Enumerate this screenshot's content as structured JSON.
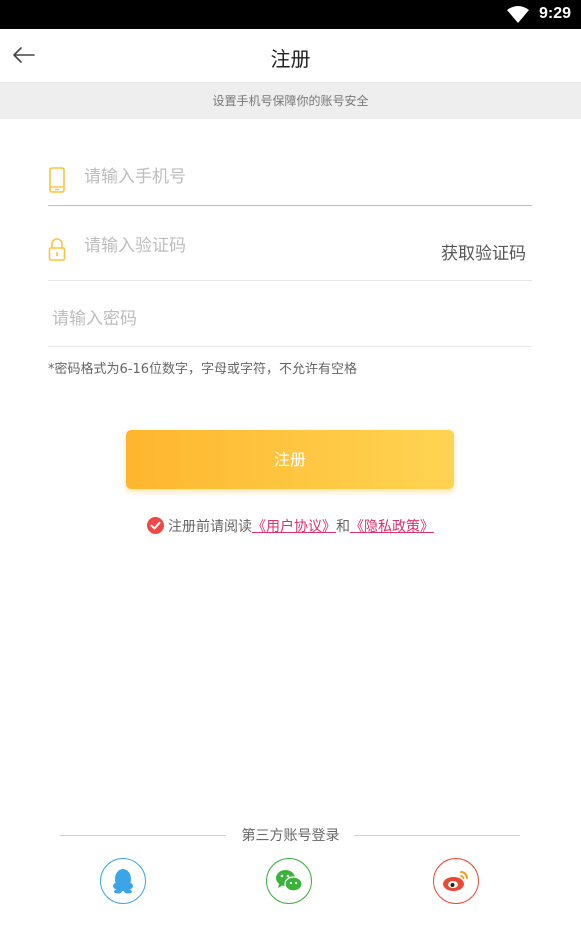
{
  "status_bar": {
    "time": "9:29",
    "wifi_icon": "wifi-icon"
  },
  "header": {
    "title": "注册",
    "back_icon": "back-arrow-icon"
  },
  "subtitle": "设置手机号保障你的账号安全",
  "form": {
    "phone": {
      "placeholder": "请输入手机号",
      "icon": "phone-icon",
      "value": ""
    },
    "code": {
      "placeholder": "请输入验证码",
      "icon": "lock-icon",
      "value": "",
      "get_code_label": "获取验证码"
    },
    "password": {
      "placeholder": "请输入密码",
      "value": ""
    },
    "hint": "*密码格式为6-16位数字，字母或字符，不允许有空格"
  },
  "register_button": "注册",
  "agreement": {
    "prefix": "注册前请阅读",
    "user_agreement": "《用户协议》",
    "and": "和",
    "privacy_policy": "《隐私政策》",
    "checked": true
  },
  "third_party": {
    "label": "第三方账号登录",
    "providers": [
      "qq",
      "wechat",
      "weibo"
    ]
  },
  "colors": {
    "accent": "#ffc23c",
    "link": "#e0306a",
    "check": "#ef4848",
    "qq": "#3aa6e8",
    "wechat": "#3bb23b",
    "weibo": "#e84a35"
  }
}
